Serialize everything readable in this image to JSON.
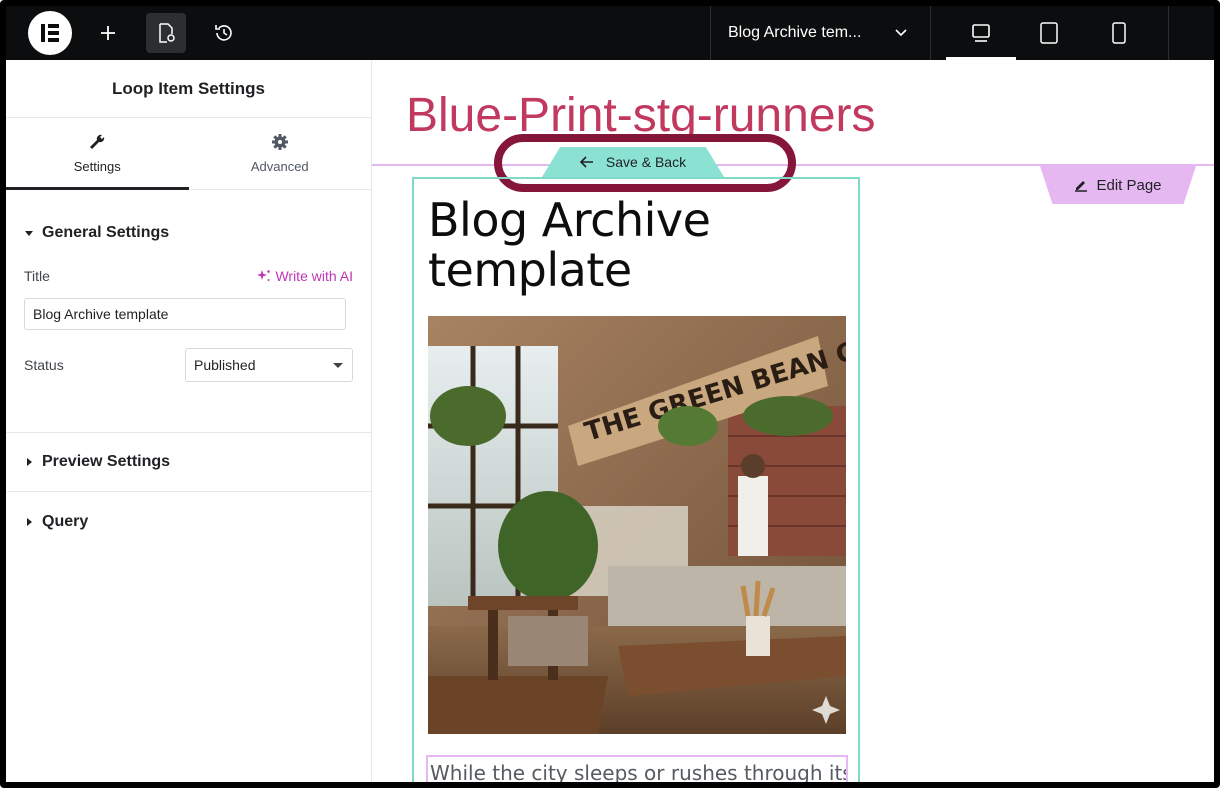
{
  "topbar": {
    "document_title": "Blog Archive tem..."
  },
  "panel": {
    "header": "Loop Item Settings",
    "tabs": [
      {
        "label": "Settings"
      },
      {
        "label": "Advanced"
      }
    ],
    "general": {
      "title": "General Settings",
      "title_label": "Title",
      "ai_link": "Write with AI",
      "title_value": "Blog Archive template",
      "status_label": "Status",
      "status_value": "Published"
    },
    "preview_settings": "Preview Settings",
    "query": "Query"
  },
  "canvas": {
    "site_title": "Blue-Print-stg-runners",
    "save_back": "Save & Back",
    "edit_page": "Edit Page",
    "post_title_line1": "Blog Archive",
    "post_title_line2": "template",
    "image_sign": "THE GREEN BEAN CAFÉ",
    "excerpt": "While the city sleeps or rushes through its"
  },
  "colors": {
    "site_title": "#c2395f",
    "accent_teal": "#8be1d2",
    "accent_pink": "#e6b8f1",
    "highlight": "#86153a"
  }
}
